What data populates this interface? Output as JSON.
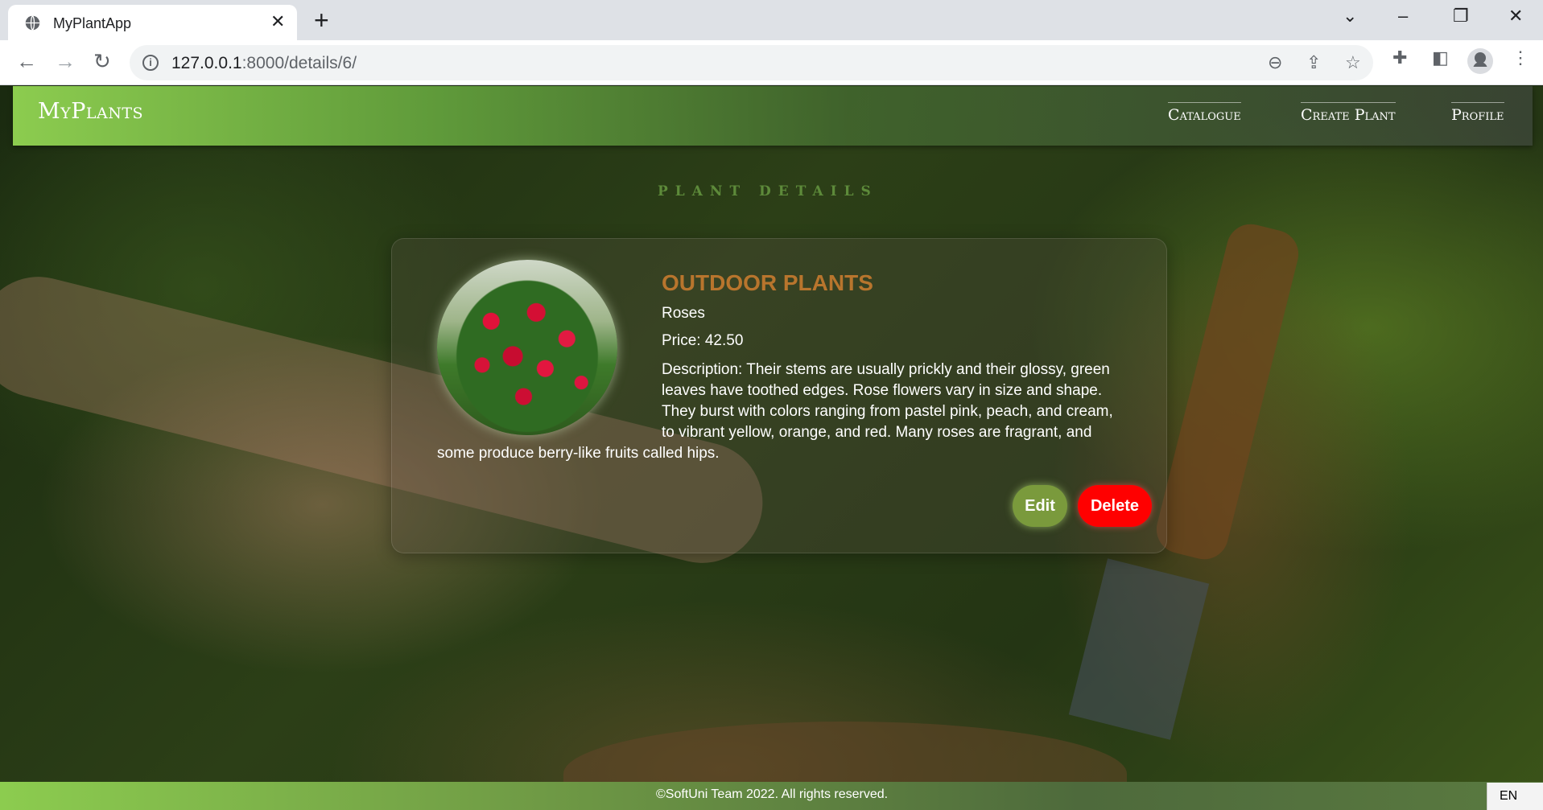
{
  "browser": {
    "tab_title": "MyPlantApp",
    "url_host": "127.0.0.1",
    "url_path": ":8000/details/6/"
  },
  "icons": {
    "tab_favicon": "globe-icon",
    "tab_close": "close-icon",
    "new_tab": "plus-icon",
    "back": "arrow-left-icon",
    "forward": "arrow-right-icon",
    "reload": "reload-icon",
    "site_info": "info-icon",
    "zoom": "zoom-out-icon",
    "share": "share-icon",
    "bookmark": "star-icon",
    "extensions": "puzzle-icon",
    "side_panel": "side-panel-icon",
    "profile": "avatar-icon",
    "menu": "kebab-menu-icon"
  },
  "header": {
    "logo": "MyPlants",
    "nav": [
      "Catalogue",
      "Create Plant",
      "Profile"
    ]
  },
  "main": {
    "section_title": "PLANT DETAILS",
    "plant": {
      "category": "OUTDOOR PLANTS",
      "name": "Roses",
      "price_text": "Price: 42.50",
      "description_text": "Description: Their stems are usually prickly and their glossy, green leaves have toothed edges. Rose flowers vary in size and shape. They burst with colors ranging from pastel pink, peach, and cream, to vibrant yellow, orange, and red. Many roses are fragrant, and some produce berry-like fruits called hips."
    },
    "actions": {
      "edit": "Edit",
      "delete": "Delete"
    }
  },
  "footer": {
    "copyright": "©SoftUni Team 2022. All rights reserved."
  },
  "taskbar": {
    "language": "EN"
  },
  "colors": {
    "brand_green": "#8ccc4f",
    "category_color": "#b8752d",
    "delete_red": "#ff0000",
    "edit_green": "#7a9a3c"
  }
}
